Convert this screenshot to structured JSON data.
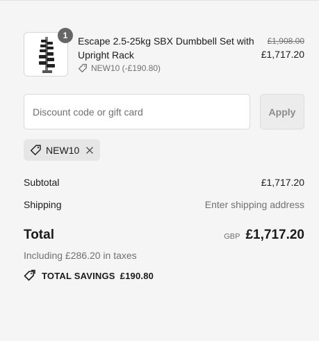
{
  "product": {
    "quantity": "1",
    "name": "Escape 2.5-25kg SBX Dumbbell Set with Upright Rack",
    "discount_label": "NEW10 (-£190.80)",
    "original_price": "£1,908.00",
    "price": "£1,717.20",
    "image_icon": "dumbbell-rack-image"
  },
  "discount": {
    "placeholder": "Discount code or gift card",
    "value": "",
    "apply_label": "Apply",
    "applied_code": "NEW10"
  },
  "summary": {
    "subtotal_label": "Subtotal",
    "subtotal_value": "£1,717.20",
    "shipping_label": "Shipping",
    "shipping_value": "Enter shipping address",
    "total_label": "Total",
    "currency": "GBP",
    "total_value": "£1,717.20",
    "taxes_text": "Including £286.20 in taxes",
    "savings_label": "TOTAL SAVINGS",
    "savings_value": "£190.80"
  },
  "colors": {
    "background": "#f5f5f5",
    "text": "#1a1a1a",
    "muted": "#707070",
    "badge": "#666666"
  }
}
